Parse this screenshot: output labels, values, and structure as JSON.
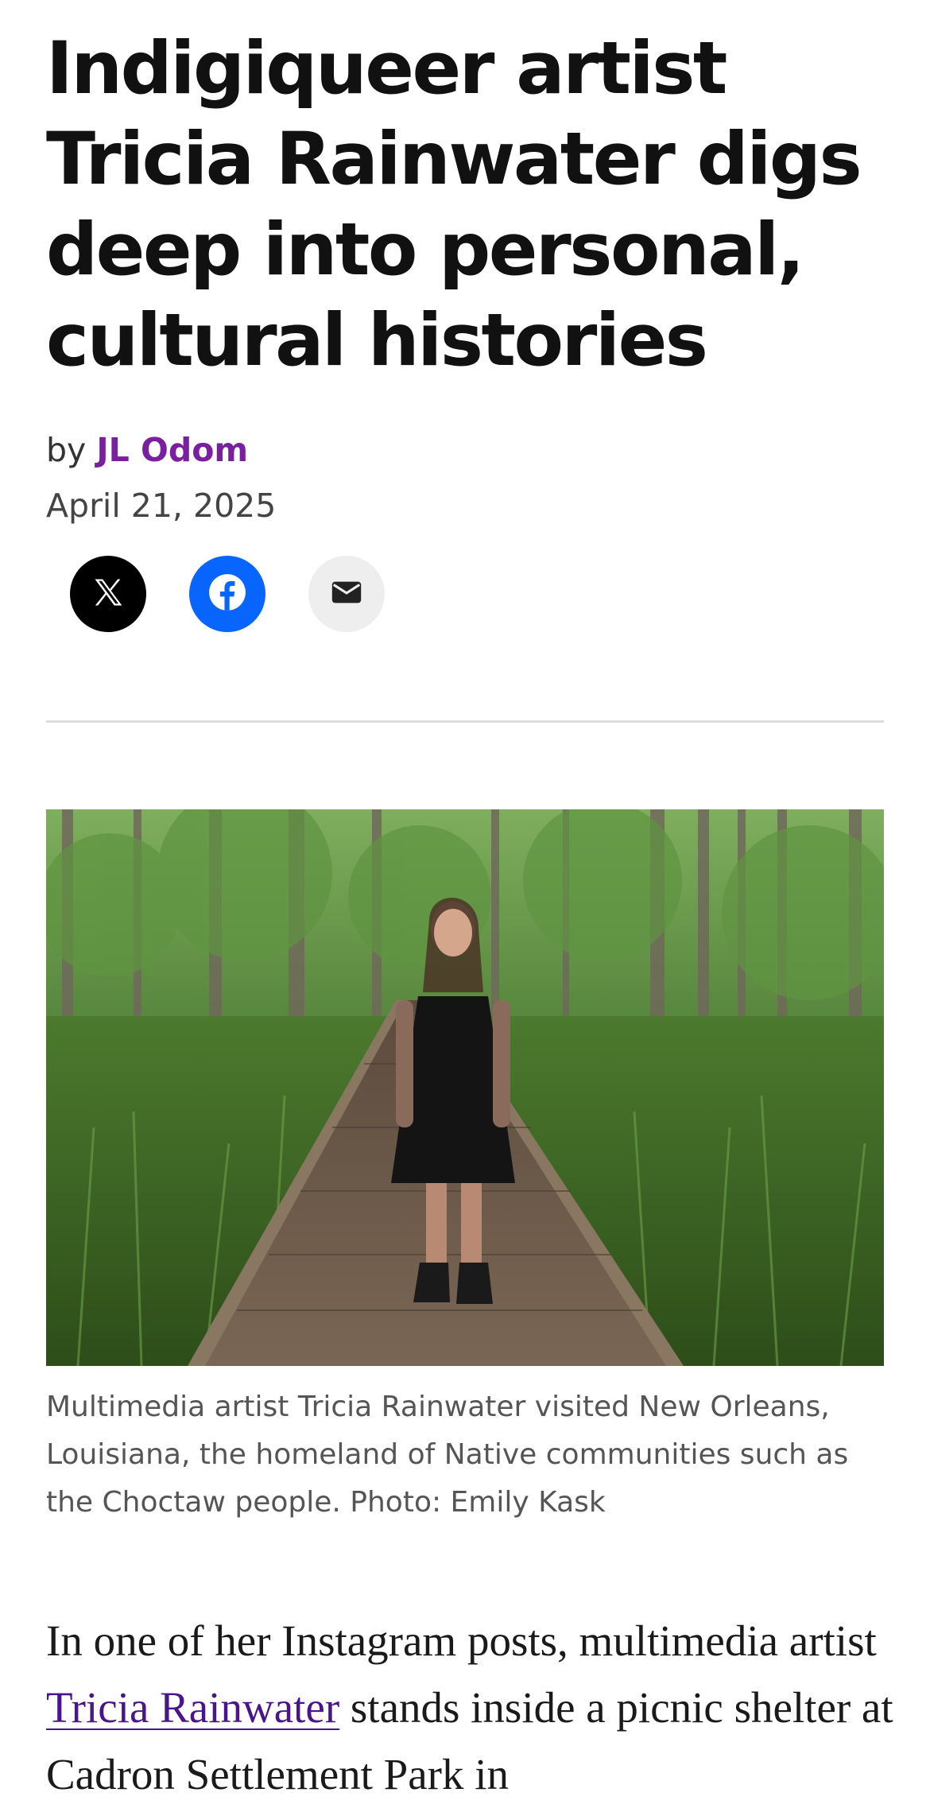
{
  "article": {
    "headline": "Indigiqueer artist Tricia Rainwater digs deep into personal, cultural histories",
    "byline_prefix": "by",
    "author": "JL Odom",
    "date": "April 21, 2025",
    "share_buttons": [
      {
        "icon": "x-logo-icon",
        "color": "#000000"
      },
      {
        "icon": "facebook-icon",
        "color": "#0866ff"
      },
      {
        "icon": "email-icon",
        "color": "#eeeeee"
      }
    ],
    "caption": "Multimedia artist Tricia Rainwater visited New Orleans, Louisiana, the homeland of Native communities such as the Choctaw people. Photo: Emily Kask",
    "body": {
      "intro_before_link": "In one of her Instagram posts, multimedia artist",
      "link_text": "Tricia Rainwater",
      "intro_after_link": "stands inside a picnic shelter at Cadron Settlement Park in"
    }
  },
  "colors": {
    "author_accent": "#7b1fa2",
    "link": "#4a148c",
    "facebook_blue": "#0866ff"
  }
}
